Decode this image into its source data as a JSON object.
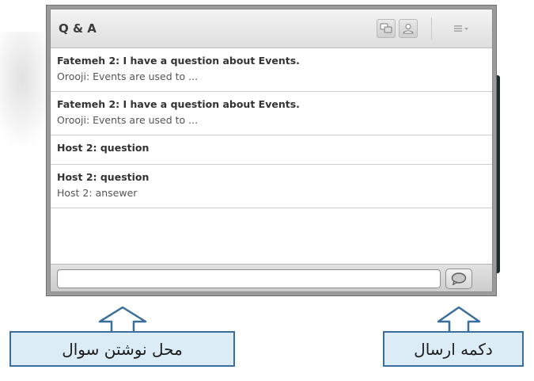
{
  "window": {
    "title": "Q & A"
  },
  "header": {
    "icons": [
      "questions-view-icon",
      "user-view-icon",
      "panel-menu-icon"
    ]
  },
  "items": [
    {
      "question": "Fatemeh 2: I have a question about Events.",
      "answer": "Orooji: Events are used to ..."
    },
    {
      "question": "Fatemeh 2: I have a question about Events.",
      "answer": "Orooji: Events are used to ..."
    },
    {
      "question": "Host 2: question",
      "answer": ""
    },
    {
      "question": "Host 2: question",
      "answer": "Host 2: ansewer"
    }
  ],
  "input": {
    "value": "",
    "placeholder": ""
  },
  "send": {
    "icon": "speech-bubble-icon"
  },
  "callouts": {
    "input_label": "محل نوشتن سوال",
    "send_label": "دکمه ارسال"
  },
  "colors": {
    "callout_fill": "#dcecf6",
    "callout_border": "#3a6f9d",
    "window_frame": "#9b9b9b"
  }
}
